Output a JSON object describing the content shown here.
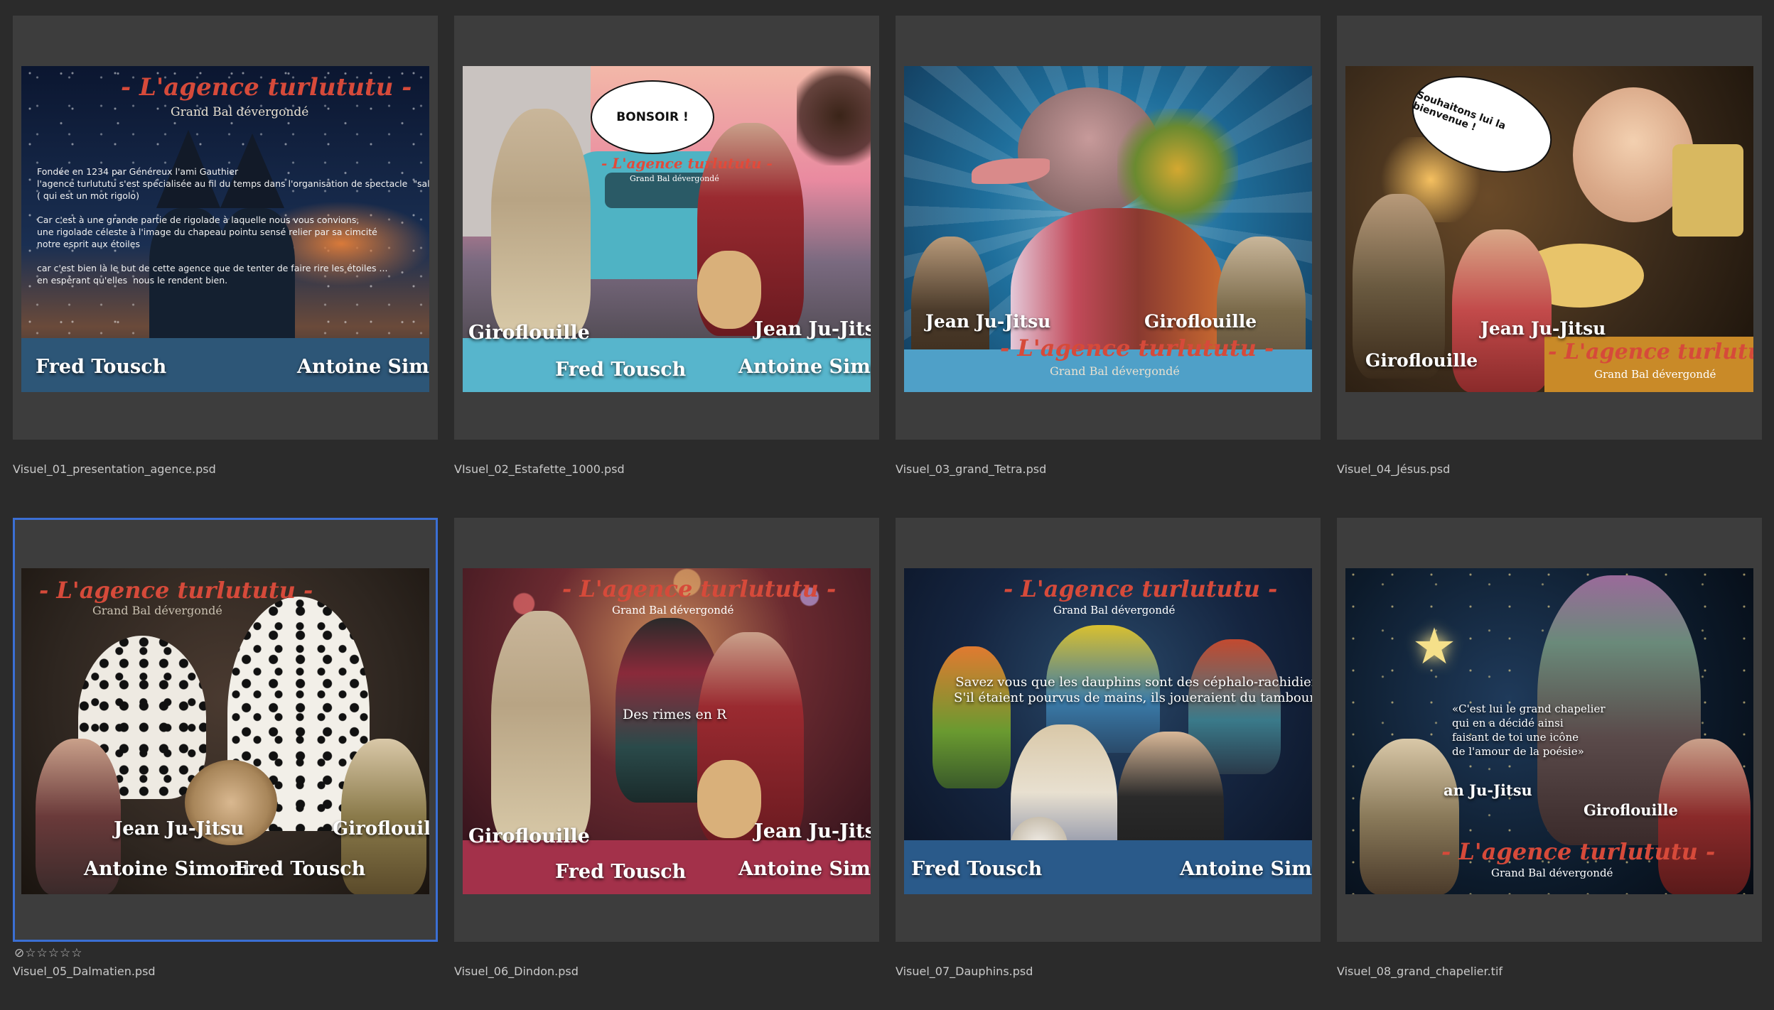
{
  "browser": {
    "items": [
      {
        "filename": "Visuel_01_presentation_agence.psd",
        "logo": "- L'agence turlututu -",
        "logo_sub": "Grand Bal dévergondé",
        "text": "Fondée en 1234 par Généreux l'ami Gauthier\nl'agence turlututu s'est spécialisée au fil du temps dans l'organisation de spectacle  \"salsifiant\"\n( qui est un mot rigolo)\n\nCar c'est à une grande partie de rigolade à laquelle nous vous convions,\nune rigolade céleste à l'image du chapeau pointu sensé relier par sa cimcité\nnotre esprit aux étoiles\n\ncar c'est bien là le but de cette agence que de tenter de faire rire les étoiles ...\nen espérant qu'elles  nous le rendent bien.",
        "name_left": "Fred Tousch",
        "name_right": "Antoine Simoni",
        "colors": {
          "bg_top": "#0d1b33",
          "bg_bottom": "#2c4a6e",
          "banner": "#2d5677",
          "glow": "#e07a3a"
        }
      },
      {
        "filename": "VIsuel_02_Estafette_1000.psd",
        "bubble": "BONSOIR !",
        "logo": "- L'agence turlututu -",
        "logo_sub": "Grand Bal dévergondé",
        "name_girof": "Giroflouille",
        "name_jean": "Jean Ju-Jitsu",
        "name_left": "Fred Tousch",
        "name_right": "Antoine Simoni",
        "colors": {
          "sky": "#e98aa0",
          "van": "#4fb3c4",
          "banner": "#57b5cc"
        }
      },
      {
        "filename": "Visuel_03_grand_Tetra.psd",
        "logo": "- L'agence turlututu -",
        "logo_sub": "Grand Bal dévergondé",
        "name_jean": "Jean Ju-Jitsu",
        "name_girof": "Giroflouille",
        "colors": {
          "bg": "#1f6f9c",
          "banner": "#4fa0c8",
          "bird": "#b7667a"
        }
      },
      {
        "filename": "Visuel_04_Jésus.psd",
        "bubble": "Souhaitons lui la bienvenue !",
        "logo": "- L'agence turlututu -",
        "logo_sub": "Grand Bal dévergondé",
        "name_jean": "Jean Ju-Jitsu",
        "name_girof": "Giroflouille",
        "colors": {
          "bg": "#3a2a1a",
          "banner": "#c98a28"
        }
      },
      {
        "filename": "Visuel_05_Dalmatien.psd",
        "rating_icons": "⊘☆☆☆☆☆",
        "logo": "- L'agence turlututu -",
        "logo_sub": "Grand Bal dévergondé",
        "name_jean": "Jean Ju-Jitsu",
        "name_girof": "Giroflouille",
        "name_left": "Antoine Simoni",
        "name_right": "Fred Tousch",
        "colors": {
          "bg": "#2e2620",
          "dog": "#eeeae2"
        }
      },
      {
        "filename": "Visuel_06_Dindon.psd",
        "logo": "- L'agence turlututu -",
        "logo_sub": "Grand Bal dévergondé",
        "caption": "Des rimes en R",
        "name_girof": "Giroflouille",
        "name_jean": "Jean Ju-Jitsu",
        "name_left": "Fred Tousch",
        "name_right": "Antoine Simoni",
        "colors": {
          "bg": "#3a1420",
          "banner": "#a3314a"
        }
      },
      {
        "filename": "Visuel_07_Dauphins.psd",
        "logo": "- L'agence turlututu -",
        "logo_sub": "Grand Bal dévergondé",
        "caption": "Savez vous que les dauphins sont des céphalo-rachidien?\nS'il étaient pourvus de mains, ils joueraient du tambourin",
        "name_left": "Fred Tousch",
        "name_right": "Antoine Simoni",
        "colors": {
          "bg": "#0f1a2e",
          "banner": "#2a5a8a"
        }
      },
      {
        "filename": "Visuel_08_grand_chapelier.tif",
        "caption": "«C'est lui le grand chapelier\nqui en a décidé ainsi\nfaisant de toi une icône\nde l'amour de la poésie»",
        "name_jean": "an Ju-Jitsu",
        "name_girof": "Giroflouille",
        "logo": "- L'agence turlututu -",
        "logo_sub": "Grand Bal dévergondé",
        "colors": {
          "bg": "#0c1a2a",
          "star": "#f5e08a"
        }
      }
    ]
  }
}
